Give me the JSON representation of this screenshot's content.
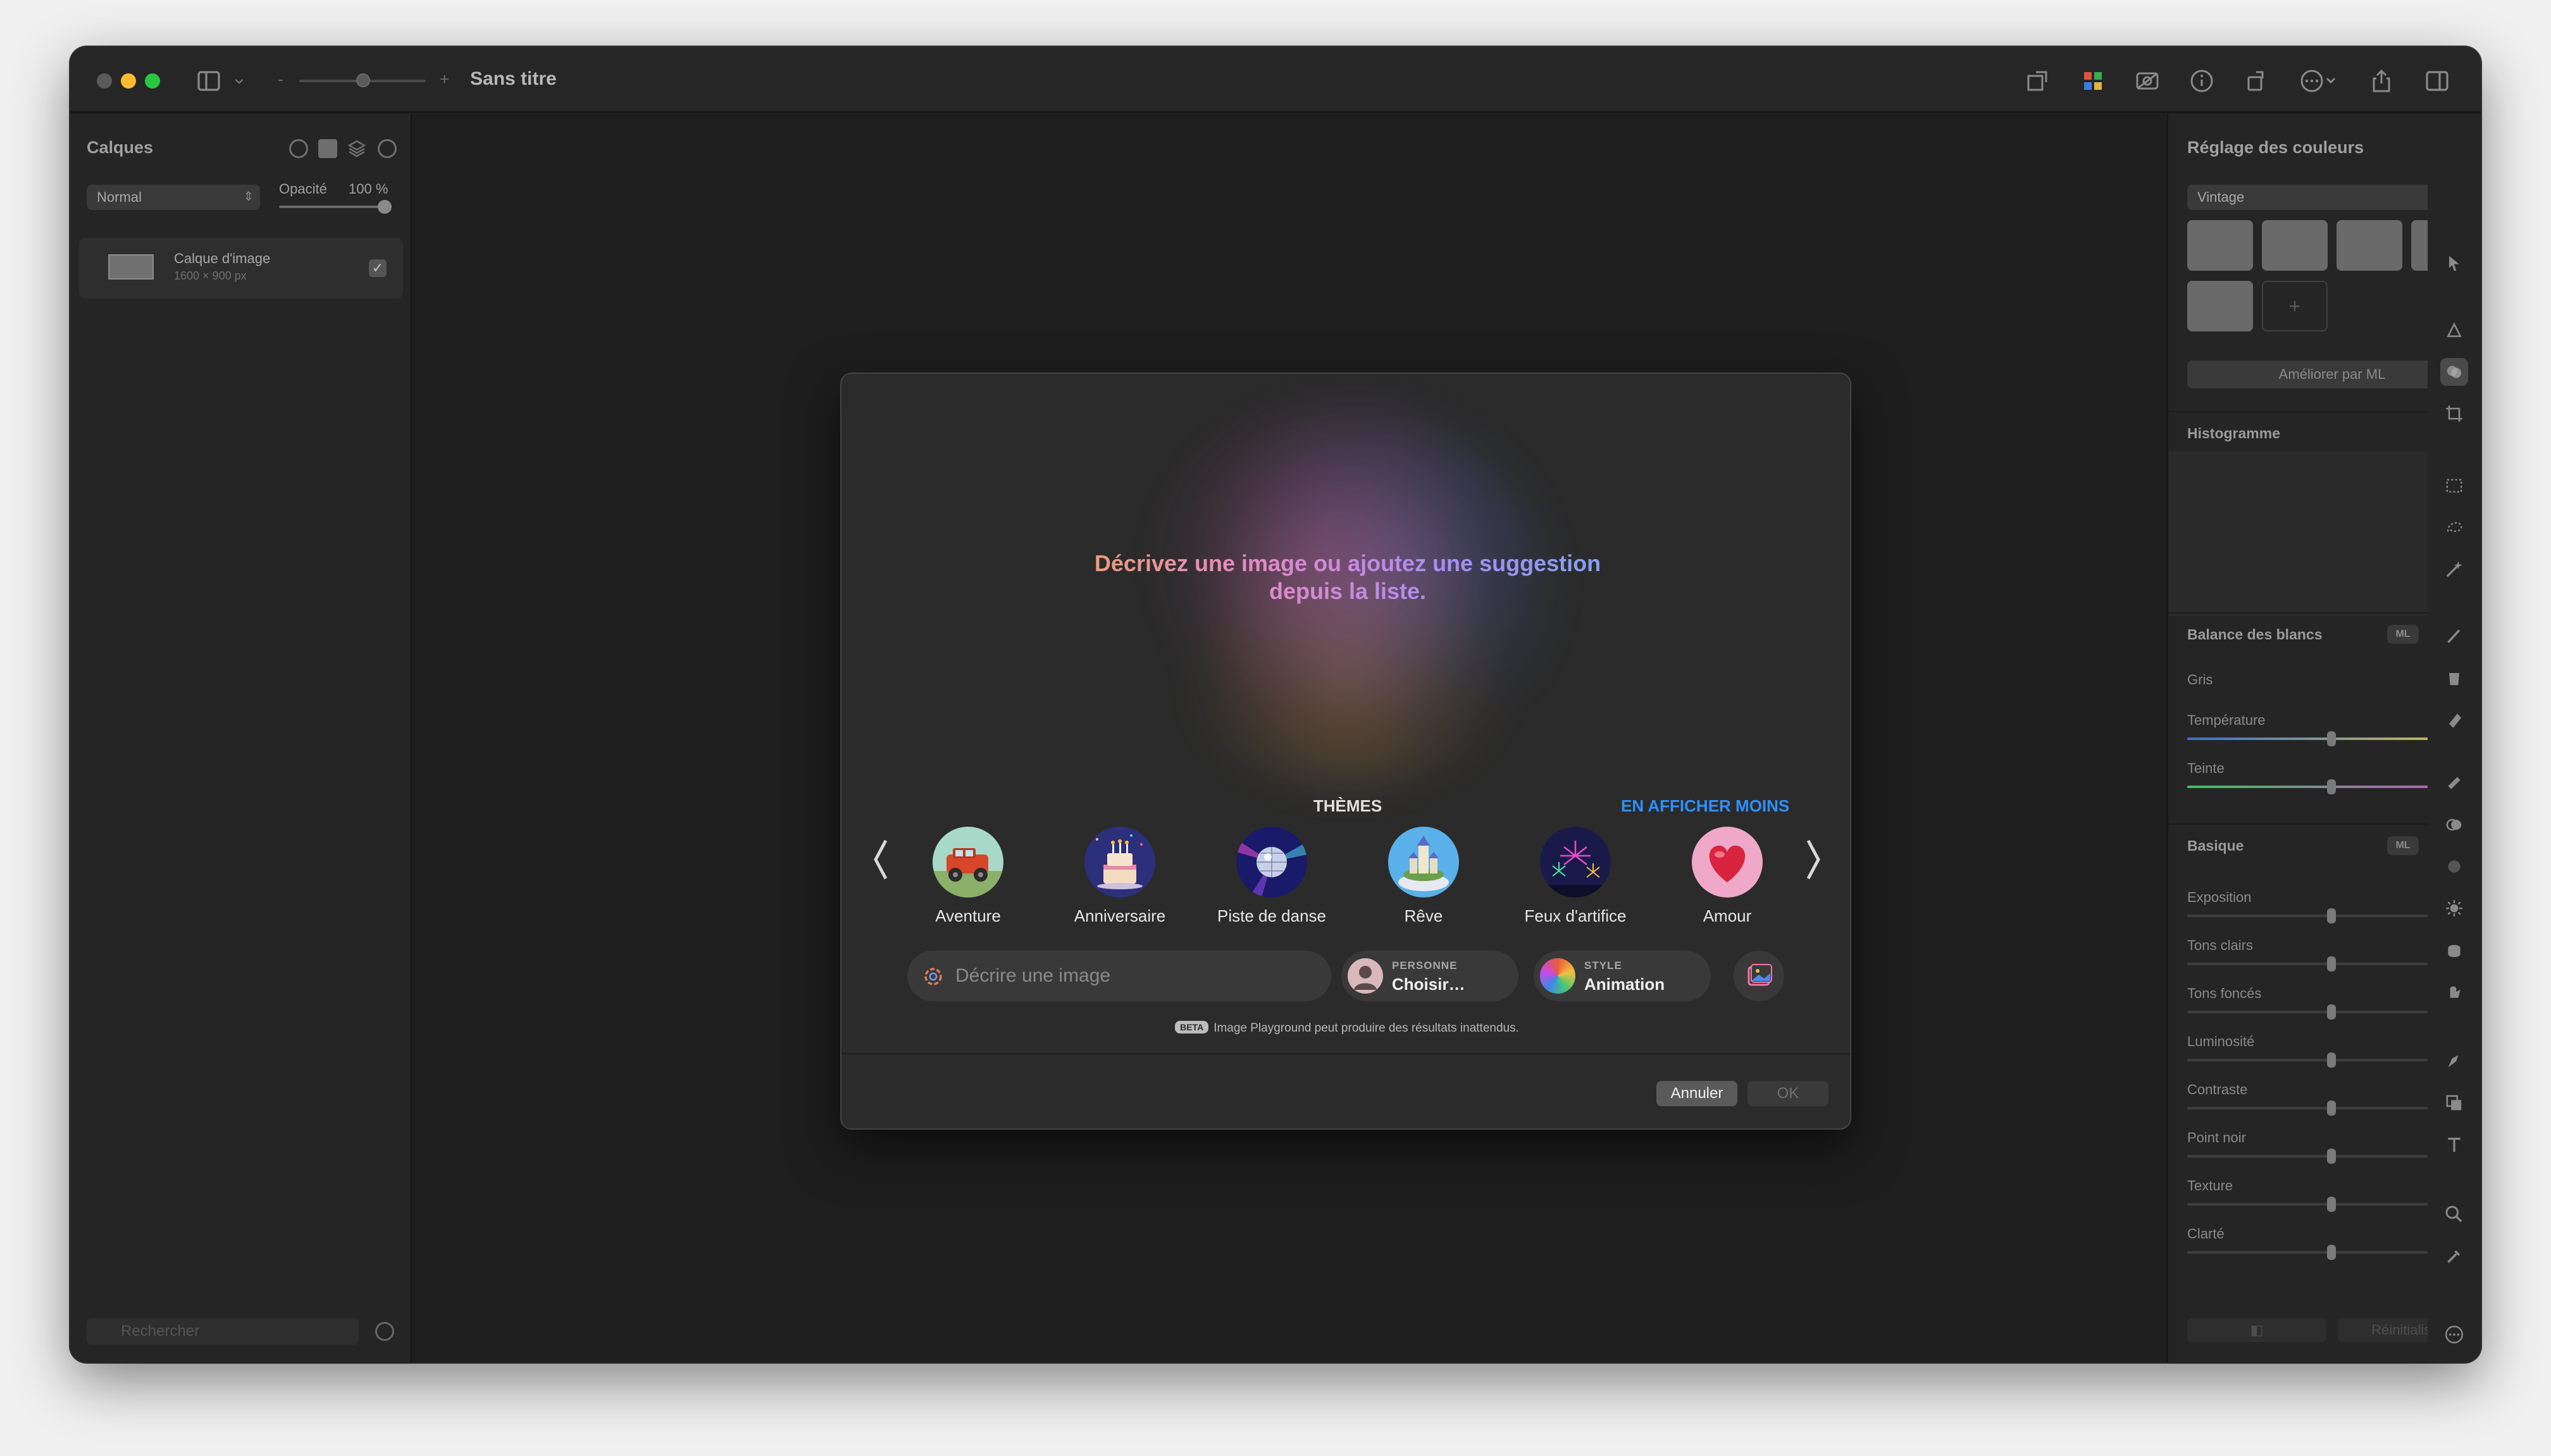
{
  "window": {
    "title": "Sans titre"
  },
  "layers_panel": {
    "title": "Calques",
    "blend_mode": "Normal",
    "opacity_label": "Opacité",
    "opacity_value": "100 %",
    "layer": {
      "name": "Calque d'image",
      "size": "1600 × 900 px"
    },
    "search_placeholder": "Rechercher"
  },
  "dialog": {
    "prompt": "Décrivez une image ou ajoutez une suggestion depuis la liste.",
    "themes_title": "THÈMES",
    "show_less": "EN AFFICHER MOINS",
    "themes": [
      {
        "label": "Aventure",
        "icon": "adventure-car-icon"
      },
      {
        "label": "Anniversaire",
        "icon": "birthday-cake-icon"
      },
      {
        "label": "Piste de danse",
        "icon": "disco-ball-icon"
      },
      {
        "label": "Rêve",
        "icon": "dream-castle-icon"
      },
      {
        "label": "Feux d'artifice",
        "icon": "fireworks-icon"
      },
      {
        "label": "Amour",
        "icon": "heart-icon"
      }
    ],
    "input_placeholder": "Décrire une image",
    "person": {
      "label": "PERSONNE",
      "value": "Choisir…"
    },
    "style": {
      "label": "STYLE",
      "value": "Animation"
    },
    "beta_badge": "BETA",
    "beta_note": "Image Playground peut produire des résultats inattendus.",
    "cancel": "Annuler",
    "ok": "OK"
  },
  "color_panel": {
    "title": "Réglage des couleurs",
    "preset": "Vintage",
    "ml_button": "Améliorer par ML",
    "histogram": "Histogramme",
    "white_balance": {
      "title": "Balance des blancs",
      "ml": "ML",
      "gray_label": "Gris",
      "temperature": {
        "label": "Température",
        "value": "0 %"
      },
      "tint": {
        "label": "Teinte",
        "value": "0 %"
      }
    },
    "basic": {
      "title": "Basique",
      "ml": "ML",
      "items": [
        {
          "label": "Exposition",
          "value": "0 %"
        },
        {
          "label": "Tons clairs",
          "value": "0 %"
        },
        {
          "label": "Tons foncés",
          "value": "0 %"
        },
        {
          "label": "Luminosité",
          "value": "0 %"
        },
        {
          "label": "Contraste",
          "value": "0 %"
        },
        {
          "label": "Point noir",
          "value": "0 %"
        },
        {
          "label": "Texture",
          "value": "0 %"
        },
        {
          "label": "Clarté",
          "value": "0 %"
        }
      ]
    },
    "bottom_left": "◧",
    "bottom_right": "Réinitialiser"
  },
  "colors": {
    "accent": "#2e90ff",
    "traffic_yellow": "#febc2e",
    "traffic_green": "#28c840"
  }
}
